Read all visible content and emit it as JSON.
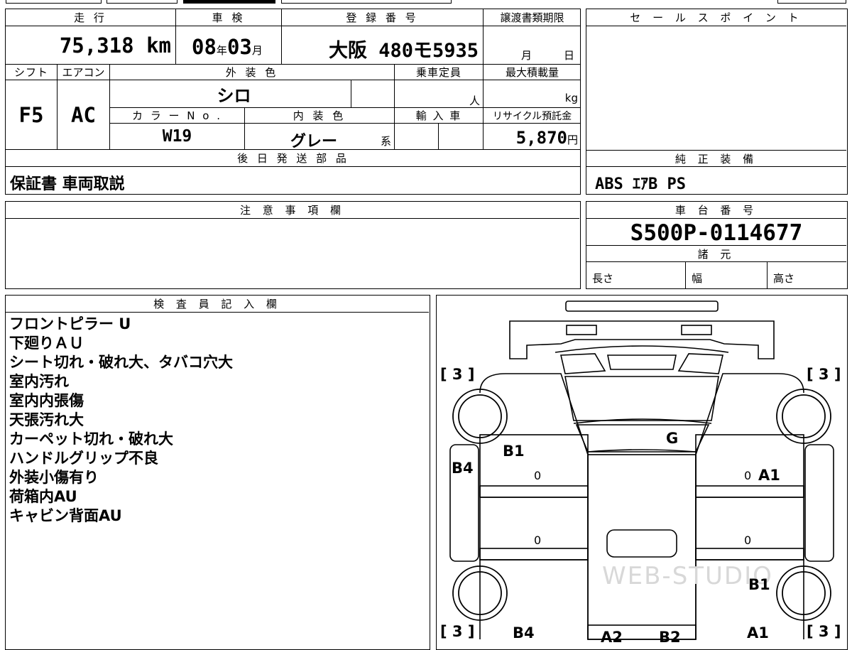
{
  "summary": {
    "mileage_label": "走 行",
    "mileage_value": "75,318",
    "mileage_unit": "km",
    "inspection_label": "車 検",
    "inspection_year": "08",
    "inspection_year_unit": "年",
    "inspection_month": "03",
    "inspection_month_unit": "月",
    "registration_label": "登 録 番 号",
    "registration_value": "大阪 480モ5935",
    "transfer_label": "譲渡書類期限",
    "transfer_month_unit": "月",
    "transfer_day_unit": "日",
    "shift_label": "シフト",
    "shift_value": "F5",
    "aircon_label": "エアコン",
    "aircon_value": "AC",
    "exterior_label": "外 装 色",
    "exterior_value": "シロ",
    "capacity_label": "乗車定員",
    "capacity_unit": "人",
    "maxload_label": "最大積載量",
    "maxload_unit": "kg",
    "color_no_label": "カ ラ ー N o .",
    "color_no_value": "W19",
    "interior_label": "内 装 色",
    "interior_value": "グレー",
    "interior_suffix": "系",
    "import_label": "輸 入 車",
    "recycle_label": "リサイクル預託金",
    "recycle_value": "5,870",
    "recycle_unit": "円"
  },
  "sales_point": {
    "label": "セ ー ル ス ポ イ ン ト"
  },
  "later_parts": {
    "label": "後 日 発 送 部 品",
    "value": "保証書 車両取説"
  },
  "equipment": {
    "label": "純 正 装 備",
    "value": "ABS ｴｱB PS"
  },
  "notes": {
    "label": "注 意 事 項 欄"
  },
  "chassis": {
    "label": "車 台 番 号",
    "value": "S500P-0114677",
    "spec_label": "諸 元",
    "length_label": "長さ",
    "width_label": "幅",
    "height_label": "高さ"
  },
  "inspector": {
    "label": "検 査 員 記 入 欄",
    "lines": [
      "フロントピラー U",
      "下廻りＡＵ",
      "シート切れ・破れ大、タバコ穴大",
      "室内汚れ",
      "室内内張傷",
      "天張汚れ大",
      "カーペット切れ・破れ大",
      "ハンドルグリップ不良",
      "外装小傷有り",
      "荷箱内AU",
      "キャビン背面AU"
    ]
  },
  "diagram": {
    "tire_tl": "[ 3 ]",
    "tire_tr": "[ 3 ]",
    "tire_bl": "[ 3 ]",
    "tire_br": "[ 3 ]",
    "mark_g": "G",
    "mark_b1_left": "B1",
    "mark_b4_left": "B4",
    "mark_a1_right": "A1",
    "mark_b1_right": "B1",
    "mark_b4_bottom": "B4",
    "mark_a1_bottom": "A1",
    "mark_a2_bottom": "A2",
    "mark_b2_bottom": "B2",
    "zero_1": "0",
    "zero_2": "0",
    "zero_3": "0",
    "zero_4": "0",
    "watermark": "WEB-STUDIO"
  }
}
